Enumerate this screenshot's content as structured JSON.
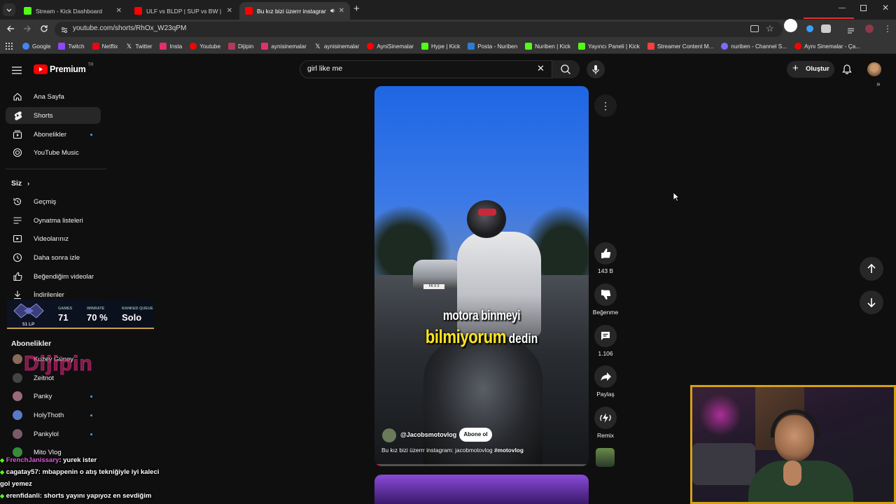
{
  "browser": {
    "tabs": [
      {
        "title": "Stream - Kick Dashboard",
        "color": "#53fc18",
        "active": false
      },
      {
        "title": "ULF vs BLDP | SUP vs BW | BJK vs",
        "color": "#ff0000",
        "active": false
      },
      {
        "title": "Bu kız bizi üzerrr instagram",
        "color": "#ff0000",
        "active": true
      }
    ],
    "url": "youtube.com/shorts/RhOx_W23qPM",
    "bookmarks": [
      {
        "label": "Google",
        "color": "#4285f4"
      },
      {
        "label": "Twitch",
        "color": "#9146ff"
      },
      {
        "label": "Netflix",
        "color": "#e50914"
      },
      {
        "label": "Twitter",
        "color": "#ffffff"
      },
      {
        "label": "Insta",
        "color": "#e1306c"
      },
      {
        "label": "Youtube",
        "color": "#ff0000"
      },
      {
        "label": "Dijipin",
        "color": "#b03a5a"
      },
      {
        "label": "aynisinemalar",
        "color": "#e1306c"
      },
      {
        "label": "aynisinemalar",
        "color": "#ffffff"
      },
      {
        "label": "AyniSinemalar",
        "color": "#ff0000"
      },
      {
        "label": "Hype | Kick",
        "color": "#53fc18"
      },
      {
        "label": "Posta - Nuriben",
        "color": "#2e7bd6"
      },
      {
        "label": "Nuriben | Kick",
        "color": "#53fc18"
      },
      {
        "label": "Yayıncı Paneli | Kick",
        "color": "#53fc18"
      },
      {
        "label": "Streamer Content M...",
        "color": "#ff3d3d"
      },
      {
        "label": "nuriben - Channel S...",
        "color": "#7a6cff"
      },
      {
        "label": "Aynı Sinemalar - Ça...",
        "color": "#ff0000"
      }
    ]
  },
  "youtube": {
    "logo": "Premium",
    "region": "TR",
    "search": {
      "value": "girl like me"
    },
    "create_label": "Oluştur"
  },
  "sidebar": {
    "main": [
      {
        "label": "Ana Sayfa",
        "icon": "home-icon"
      },
      {
        "label": "Shorts",
        "icon": "shorts-icon",
        "active": true
      },
      {
        "label": "Abonelikler",
        "icon": "subscriptions-icon",
        "dot": true
      },
      {
        "label": "YouTube Music",
        "icon": "music-icon"
      }
    ],
    "you_heading": "Siz",
    "you": [
      {
        "label": "Geçmiş",
        "icon": "history-icon"
      },
      {
        "label": "Oynatma listeleri",
        "icon": "playlist-icon"
      },
      {
        "label": "Videolarınız",
        "icon": "video-icon"
      },
      {
        "label": "Daha sonra izle",
        "icon": "clock-icon"
      },
      {
        "label": "Beğendiğim videolar",
        "icon": "like-icon"
      },
      {
        "label": "İndirilenler",
        "icon": "download-icon"
      }
    ],
    "subs_heading": "Abonelikler",
    "subs": [
      {
        "label": "Kuzey Güney",
        "color": "#8a6a5a",
        "dot": false
      },
      {
        "label": "Zeitnot",
        "color": "#444444",
        "dot": false
      },
      {
        "label": "Panky",
        "color": "#9a6a7a",
        "dot": true
      },
      {
        "label": "HolyThoth",
        "color": "#5a7ac8",
        "dot": true
      },
      {
        "label": "Pankylol",
        "color": "#7a5a6a",
        "dot": true
      },
      {
        "label": "Mito Vlog",
        "color": "#3a8a3a",
        "dot": false
      }
    ]
  },
  "lol_widget": {
    "games_label": "GAMES",
    "games": "71",
    "winrate_label": "WINRATE",
    "winrate": "70 %",
    "queue_label": "RANKED QUEUE",
    "queue": "Solo",
    "lp": "51 LP"
  },
  "watermark": "Dijipin",
  "short": {
    "caption_line1": "motora binmeyi",
    "caption_line2a": "bilmiyorum",
    "caption_line2b": "dedin",
    "plate": "FK 6 0",
    "channel": "@Jacobsmotovlog",
    "subscribe": "Abone ol",
    "description": "Bu kız bizi üzerrr instagram: jacobmotovlog",
    "hashtag": "#motovlog"
  },
  "actions": {
    "likes": "143 B",
    "dislike": "Beğenme",
    "comments": "1.106",
    "share": "Paylaş",
    "remix": "Remix"
  },
  "chat": [
    {
      "user": "FrenchJanissary",
      "msg": ": yurek ister",
      "color": "#e05adb"
    },
    {
      "user": "cagatay57",
      "msg": ": mbappenin o atış tekniğiyle iyi kaleci",
      "color": "#ffffff"
    },
    {
      "user": "",
      "msg": "gol yemez",
      "color": "#ffffff"
    },
    {
      "user": "erenfidanli",
      "msg": ": shorts yayını yapıyoz en sevdiğim",
      "color": "#ffffff"
    }
  ]
}
